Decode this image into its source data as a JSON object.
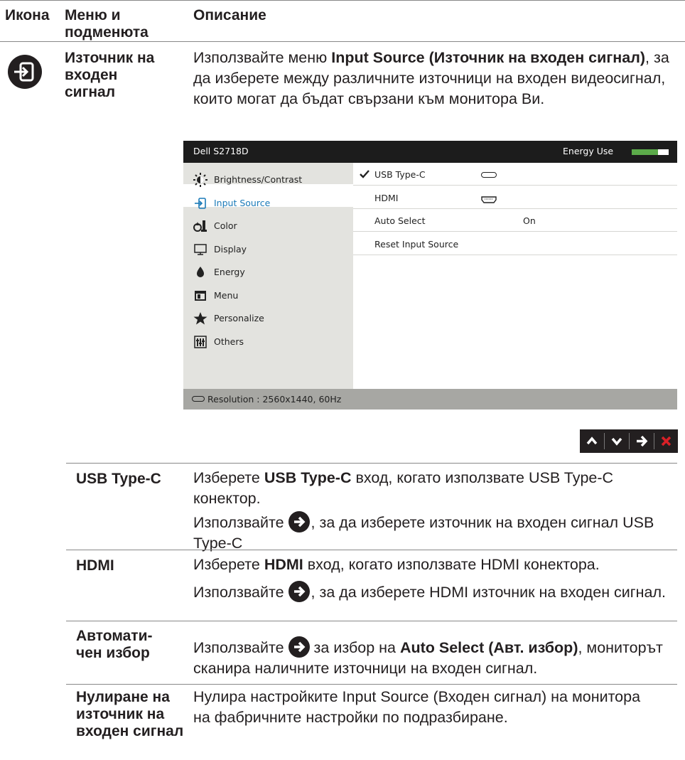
{
  "header": {
    "col_icon": "Икона",
    "col_menu": "Меню и подменюта",
    "col_desc": "Описание"
  },
  "section": {
    "name": "Източник на входен сигнал",
    "desc_prefix": "Използвайте меню ",
    "desc_bold": "Input Source (Източник на входен сигнал)",
    "desc_suffix": ", за да изберете между различните източници на входен видеосигнал, които могат да бъдат свързани към монитора Ви."
  },
  "osd": {
    "model": "Dell S2718D",
    "energy_label": "Energy Use",
    "energy_level": 0.72,
    "menu_items": [
      {
        "label": "Brightness/Contrast",
        "icon": "brightness-icon"
      },
      {
        "label": "Input Source",
        "icon": "input-source-icon",
        "selected": true
      },
      {
        "label": "Color",
        "icon": "color-icon"
      },
      {
        "label": "Display",
        "icon": "display-icon"
      },
      {
        "label": "Energy",
        "icon": "energy-icon"
      },
      {
        "label": "Menu",
        "icon": "menu-icon"
      },
      {
        "label": "Personalize",
        "icon": "star-icon"
      },
      {
        "label": "Others",
        "icon": "others-icon"
      }
    ],
    "options": [
      {
        "label": "USB Type-C",
        "checked": true,
        "icon": "usb-c-icon",
        "value": ""
      },
      {
        "label": "HDMI",
        "checked": false,
        "icon": "hdmi-icon",
        "value": ""
      },
      {
        "label": "Auto Select",
        "checked": false,
        "icon": "",
        "value": "On"
      },
      {
        "label": "Reset Input Source",
        "checked": false,
        "icon": "",
        "value": ""
      }
    ],
    "status": "Resolution : 2560x1440, 60Hz",
    "nav_buttons": [
      "up-icon",
      "down-icon",
      "right-arrow-icon",
      "close-icon"
    ],
    "colors": {
      "titlebar": "#1c1c1c",
      "left_panel": "#e3e3df",
      "status_bar": "#a7a7a3",
      "energy_bar": "#5cab4a",
      "selected": "#1a7ab8",
      "close": "#d92027"
    }
  },
  "rows": [
    {
      "name": "USB Type-C",
      "p1_prefix": "Изберете ",
      "p1_bold": "USB Type-C",
      "p1_suffix": " вход, когато използвате USB Type-C конектор.",
      "p2_prefix": "Използвайте ",
      "p2_suffix": ", за да изберете източник на входен сигнал USB Type-C"
    },
    {
      "name": "HDMI",
      "p1_prefix": "Изберете ",
      "p1_bold": "HDMI",
      "p1_suffix": " вход, когато използвате HDMI конектора.",
      "p2_prefix": "Използвайте ",
      "p2_suffix": ", за да изберете HDMI източник на входен сигнал."
    },
    {
      "name_line1": "Автомати-",
      "name_line2": "чен избор",
      "p1_prefix": "Използвайте ",
      "p1_bold": "Auto Select (Авт. избор)",
      "p1_suffix": ", мониторът сканира наличните източници на входен сигнал."
    },
    {
      "name": "Нулиране на източник на входен сигнал",
      "p1": "Нулира настройките Input Source (Входен сигнал) на монитора на фабричните настройки по подразбиране."
    }
  ]
}
